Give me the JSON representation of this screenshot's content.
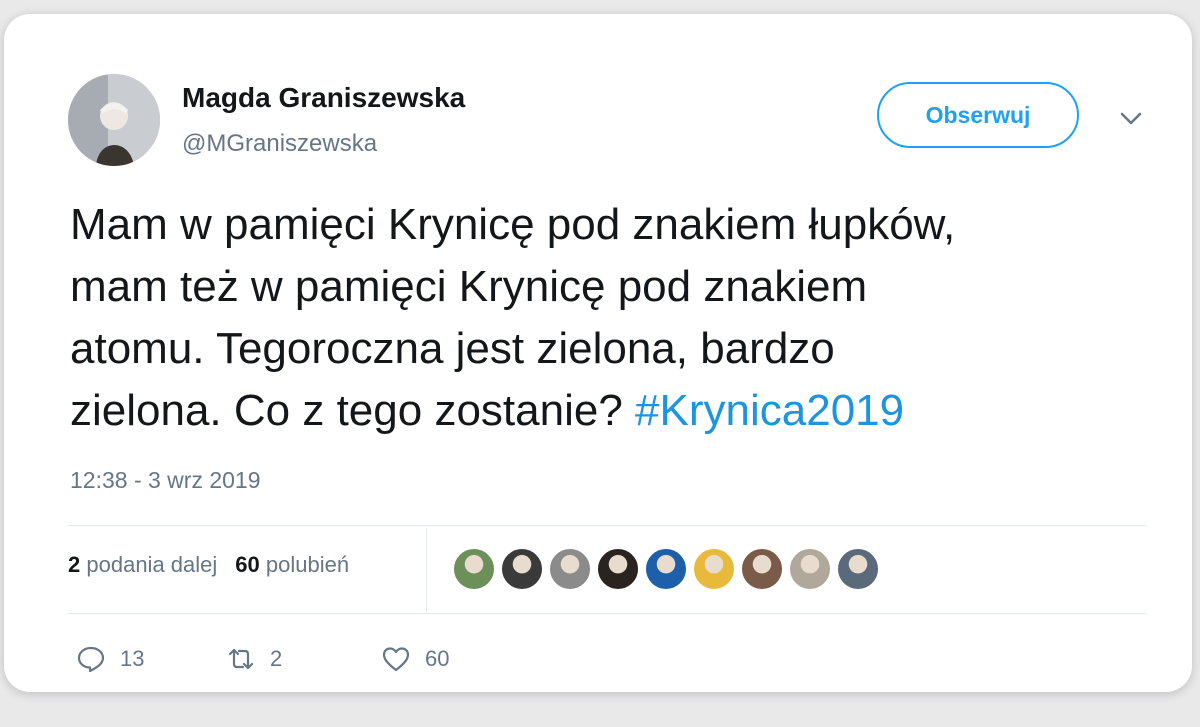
{
  "user": {
    "name": "Magda Graniszewska",
    "handle": "@MGraniszewska"
  },
  "follow_button": {
    "label": "Obserwuj"
  },
  "tweet": {
    "text": "Mam w pamięci Krynicę pod znakiem łupków,\nmam też w pamięci Krynicę pod znakiem\natomu. Tegoroczna jest zielona, bardzo\nzielona. Co z tego zostanie? ",
    "hashtag": "#Krynica2019",
    "timestamp": "12:38 - 3 wrz 2019"
  },
  "stats": {
    "retweets_count": "2",
    "retweets_label": "podania dalej",
    "likes_count": "60",
    "likes_label": "polubień"
  },
  "likers": [
    {
      "color": "#6d8f5a"
    },
    {
      "color": "#3a3a3a"
    },
    {
      "color": "#8b8b8b"
    },
    {
      "color": "#2a2420"
    },
    {
      "color": "#1d5fa8"
    },
    {
      "color": "#e8b93a"
    },
    {
      "color": "#7a5a48"
    },
    {
      "color": "#b0a89a"
    },
    {
      "color": "#5a6a7a"
    }
  ],
  "actions": {
    "reply_count": "13",
    "retweet_count": "2",
    "like_count": "60"
  },
  "icons": {
    "reply": "reply-icon",
    "retweet": "retweet-icon",
    "like": "heart-icon",
    "more": "chevron-down-icon"
  },
  "colors": {
    "accent": "#1da1f2",
    "hashtag": "#1b95e0",
    "muted": "#657786"
  }
}
